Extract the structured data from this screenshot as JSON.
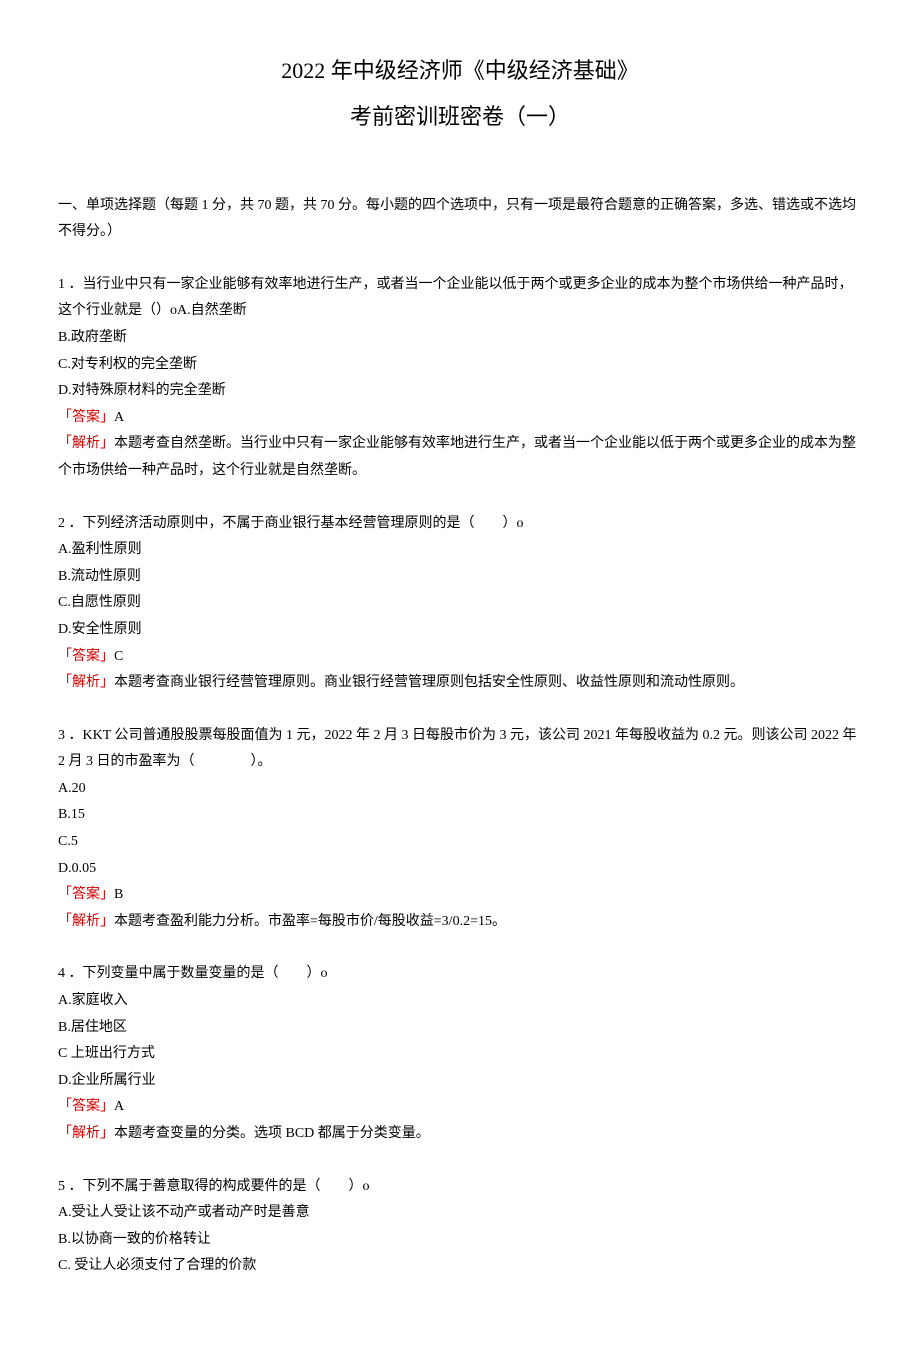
{
  "title": "2022 年中级经济师《中级经济基础》",
  "subtitle": "考前密训班密卷（一）",
  "instruction": "一、单项选择题（每题 1 分，共 70 题，共 70 分。每小题的四个选项中，只有一项是最符合题意的正确答案，多选、错选或不选均不得分。）",
  "answer_label": "「答案」",
  "explain_label": "「解析」",
  "q1": {
    "stem": "1 ．当行业中只有一家企业能够有效率地进行生产，或者当一个企业能以低于两个或更多企业的成本为整个市场供给一种产品时，这个行业就是（）oA.自然垄断",
    "b": "B.政府垄断",
    "c": "C.对专利权的完全垄断",
    "d": "D.对特殊原材料的完全垄断",
    "answer": "A",
    "explain": "本题考查自然垄断。当行业中只有一家企业能够有效率地进行生产，或者当一个企业能以低于两个或更多企业的成本为整个市场供给一种产品时，这个行业就是自然垄断。"
  },
  "q2": {
    "stem": "2 ．下列经济活动原则中，不属于商业银行基本经营管理原则的是（　　）o",
    "a": "A.盈利性原则",
    "b": "B.流动性原则",
    "c": "C.自愿性原则",
    "d": "D.安全性原则",
    "answer": "C",
    "explain": "本题考查商业银行经营管理原则。商业银行经营管理原则包括安全性原则、收益性原则和流动性原则。"
  },
  "q3": {
    "stem": "3 ．KKT 公司普通股股票每股面值为 1 元，2022 年 2 月 3 日每股市价为 3 元，该公司 2021 年每股收益为 0.2 元。则该公司 2022 年 2 月 3 日的市盈率为（　　　　）。",
    "a": "A.20",
    "b": "B.15",
    "c": "C.5",
    "d": "D.0.05",
    "answer": "B",
    "explain": "本题考查盈利能力分析。市盈率=每股市价/每股收益=3/0.2=15。"
  },
  "q4": {
    "stem": "4 ．下列变量中属于数量变量的是（　　）o",
    "a": "A.家庭收入",
    "b": "B.居住地区",
    "c": "C 上班出行方式",
    "d": "D.企业所属行业",
    "answer": "A",
    "explain": "本题考查变量的分类。选项 BCD 都属于分类变量。"
  },
  "q5": {
    "stem": "5 ．下列不属于善意取得的构成要件的是（　　）o",
    "a": "A.受让人受让该不动产或者动产时是善意",
    "b": "B.以协商一致的价格转让",
    "c": "C. 受让人必须支付了合理的价款"
  }
}
